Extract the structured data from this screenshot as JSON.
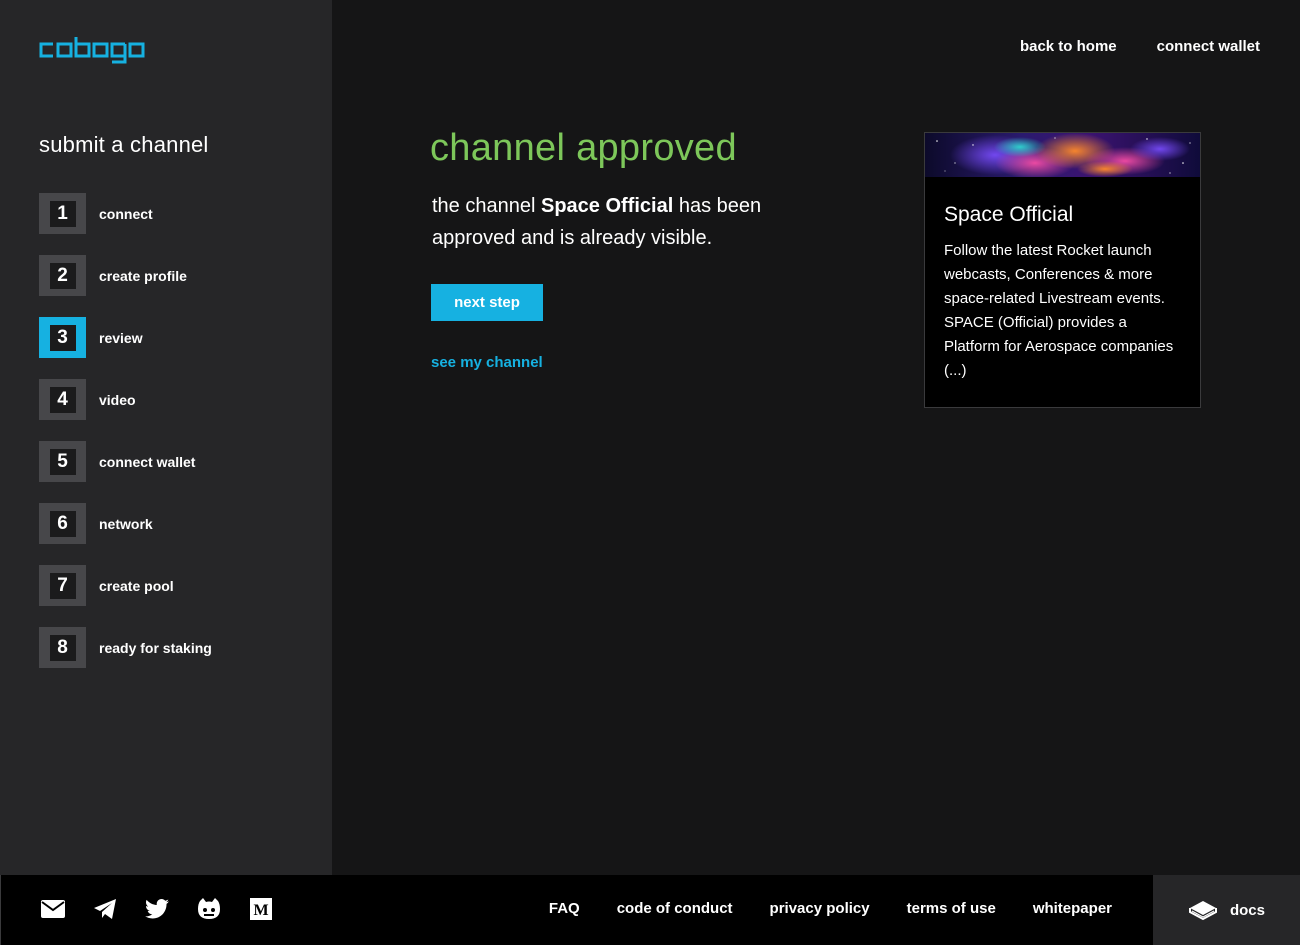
{
  "brand": {
    "name": "cobogo",
    "accent": "#16b1e1",
    "success": "#7dc75a"
  },
  "header": {
    "back_home": "back to home",
    "connect_wallet": "connect wallet"
  },
  "sidebar": {
    "title": "submit a channel",
    "steps": [
      {
        "num": "1",
        "label": "connect"
      },
      {
        "num": "2",
        "label": "create profile"
      },
      {
        "num": "3",
        "label": "review",
        "active": true
      },
      {
        "num": "4",
        "label": "video"
      },
      {
        "num": "5",
        "label": "connect wallet"
      },
      {
        "num": "6",
        "label": "network"
      },
      {
        "num": "7",
        "label": "create pool"
      },
      {
        "num": "8",
        "label": "ready for staking"
      }
    ]
  },
  "main": {
    "title": "channel approved",
    "text_prefix": "the channel ",
    "channel_name": "Space Official",
    "text_suffix": " has been approved and is already visible.",
    "next_button": "next step",
    "see_channel": "see my channel"
  },
  "card": {
    "title": "Space Official",
    "description": "Follow the latest Rocket launch webcasts, Conferences & more space-related Livestream events. SPACE (Official) provides a Platform for Aerospace companies (...)"
  },
  "footer": {
    "social_icons": [
      "mail-icon",
      "telegram-icon",
      "twitter-icon",
      "github-icon",
      "medium-icon"
    ],
    "links": [
      "FAQ",
      "code of conduct",
      "privacy policy",
      "terms of use",
      "whitepaper"
    ],
    "docs": "docs"
  }
}
